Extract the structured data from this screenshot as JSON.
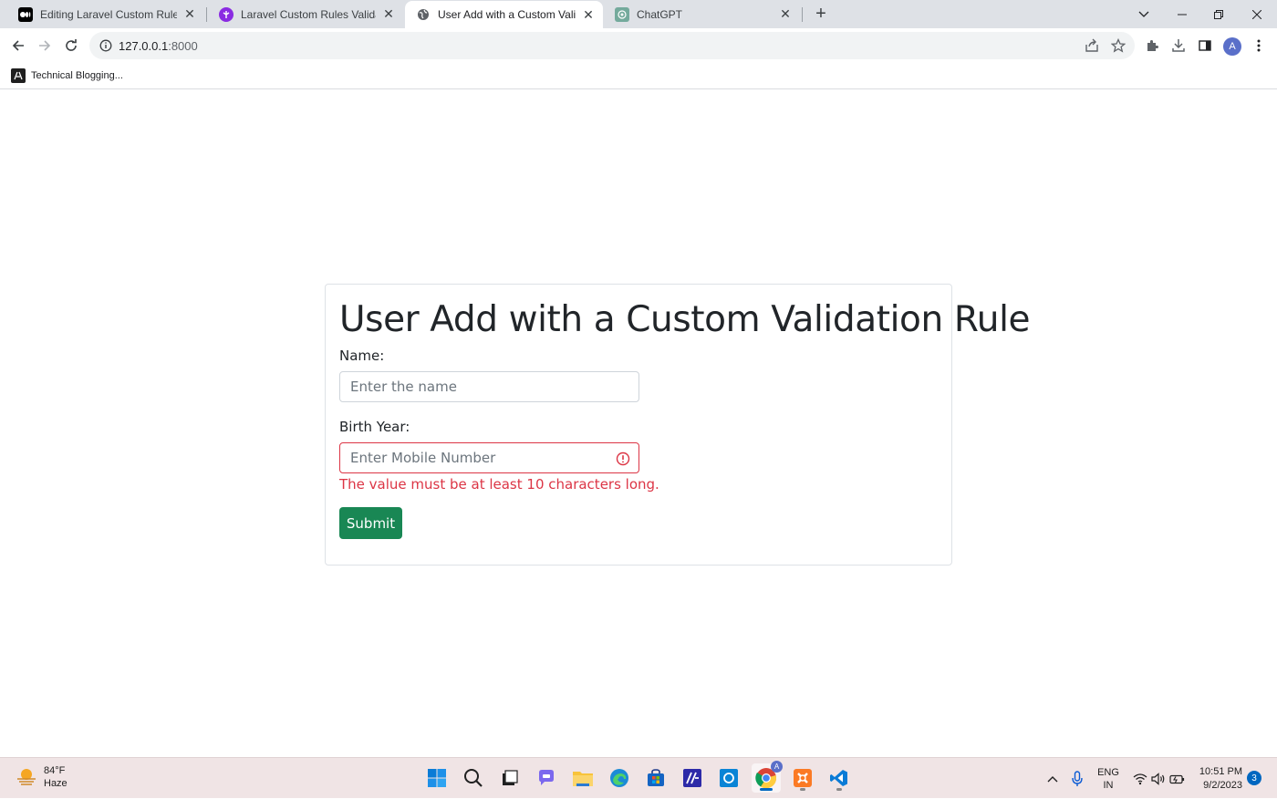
{
  "browser": {
    "tabs": [
      {
        "title": "Editing Laravel Custom Rules Vali",
        "icon": "medium-icon",
        "active": false
      },
      {
        "title": "Laravel Custom Rules Validation:",
        "icon": "site-icon",
        "active": false
      },
      {
        "title": "User Add with a Custom Validatic",
        "icon": "globe-icon",
        "active": true
      },
      {
        "title": "ChatGPT",
        "icon": "chatgpt-icon",
        "active": false
      }
    ],
    "close_glyph": "✕",
    "new_tab_glyph": "+",
    "url_host": "127.0.0.1",
    "url_port": ":8000",
    "profile_initial": "A",
    "bookmark": {
      "label": "Technical Blogging..."
    }
  },
  "page": {
    "heading": "User Add with a Custom Validation Rule",
    "name_label": "Name:",
    "name_placeholder": "Enter the name",
    "birth_label": "Birth Year:",
    "birth_placeholder": "Enter Mobile Number",
    "error_message": "The value must be at least 10 characters long.",
    "submit_label": "Submit"
  },
  "taskbar": {
    "weather_temp": "84°F",
    "weather_desc": "Haze",
    "lang_line1": "ENG",
    "lang_line2": "IN",
    "time": "10:51 PM",
    "date": "9/2/2023",
    "notification_count": "3",
    "chrome_badge": "A"
  },
  "colors": {
    "accent_green": "#198754",
    "error_red": "#dc3545",
    "taskbar_bg": "#f0e4e5"
  }
}
